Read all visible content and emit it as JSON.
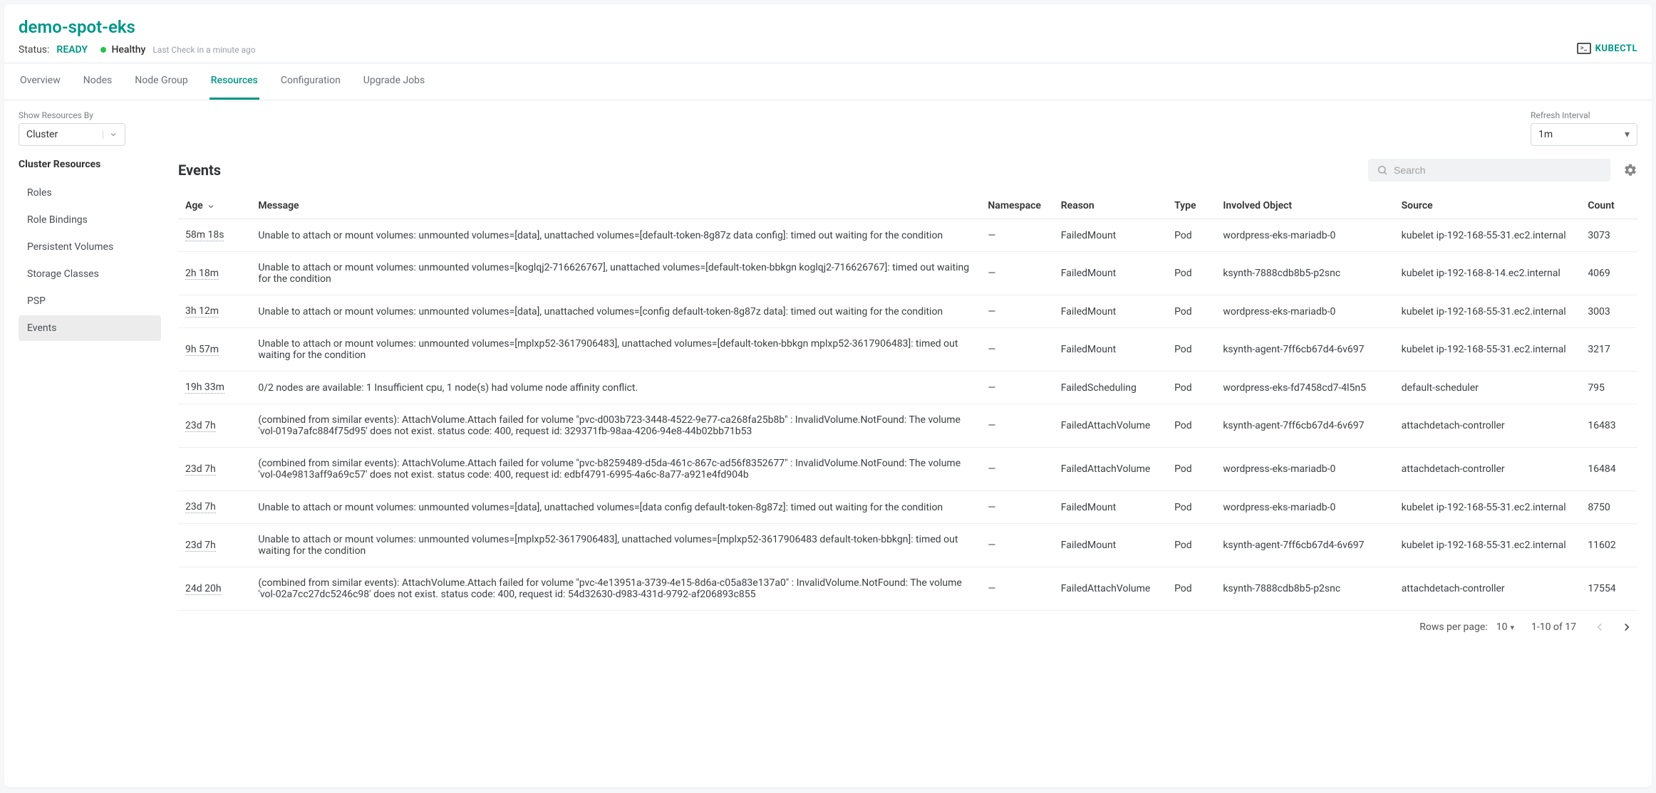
{
  "header": {
    "title": "demo-spot-eks",
    "status_label": "Status:",
    "status_value": "READY",
    "health": "Healthy",
    "last_check": "Last Check in a minute ago",
    "kubectl_label": "KUBECTL"
  },
  "tabs": [
    "Overview",
    "Nodes",
    "Node Group",
    "Resources",
    "Configuration",
    "Upgrade Jobs"
  ],
  "active_tab": "Resources",
  "show_resources_by": {
    "label": "Show Resources By",
    "value": "Cluster"
  },
  "refresh_interval": {
    "label": "Refresh Interval",
    "value": "1m"
  },
  "sidebar": {
    "title": "Cluster Resources",
    "items": [
      "Roles",
      "Role Bindings",
      "Persistent Volumes",
      "Storage Classes",
      "PSP",
      "Events"
    ],
    "active": "Events"
  },
  "events": {
    "title": "Events",
    "search_placeholder": "Search",
    "columns": [
      "Age",
      "Message",
      "Namespace",
      "Reason",
      "Type",
      "Involved Object",
      "Source",
      "Count"
    ],
    "rows": [
      {
        "age": "58m 18s",
        "message": "Unable to attach or mount volumes: unmounted volumes=[data], unattached volumes=[default-token-8g87z data config]: timed out waiting for the condition",
        "namespace": "—",
        "reason": "FailedMount",
        "type": "Pod",
        "involved": "wordpress-eks-mariadb-0",
        "source": "kubelet ip-192-168-55-31.ec2.internal",
        "count": "3073"
      },
      {
        "age": "2h 18m",
        "message": "Unable to attach or mount volumes: unmounted volumes=[koglqj2-716626767], unattached volumes=[default-token-bbkgn koglqj2-716626767]: timed out waiting for the condition",
        "namespace": "—",
        "reason": "FailedMount",
        "type": "Pod",
        "involved": "ksynth-7888cdb8b5-p2snc",
        "source": "kubelet ip-192-168-8-14.ec2.internal",
        "count": "4069"
      },
      {
        "age": "3h 12m",
        "message": "Unable to attach or mount volumes: unmounted volumes=[data], unattached volumes=[config default-token-8g87z data]: timed out waiting for the condition",
        "namespace": "—",
        "reason": "FailedMount",
        "type": "Pod",
        "involved": "wordpress-eks-mariadb-0",
        "source": "kubelet ip-192-168-55-31.ec2.internal",
        "count": "3003"
      },
      {
        "age": "9h 57m",
        "message": "Unable to attach or mount volumes: unmounted volumes=[mplxp52-3617906483], unattached volumes=[default-token-bbkgn mplxp52-3617906483]: timed out waiting for the condition",
        "namespace": "—",
        "reason": "FailedMount",
        "type": "Pod",
        "involved": "ksynth-agent-7ff6cb67d4-6v697",
        "source": "kubelet ip-192-168-55-31.ec2.internal",
        "count": "3217"
      },
      {
        "age": "19h 33m",
        "message": "0/2 nodes are available: 1 Insufficient cpu, 1 node(s) had volume node affinity conflict.",
        "namespace": "—",
        "reason": "FailedScheduling",
        "type": "Pod",
        "involved": "wordpress-eks-fd7458cd7-4l5n5",
        "source": "default-scheduler",
        "count": "795"
      },
      {
        "age": "23d 7h",
        "message": "(combined from similar events): AttachVolume.Attach failed for volume \"pvc-d003b723-3448-4522-9e77-ca268fa25b8b\" : InvalidVolume.NotFound: The volume 'vol-019a7afc884f75d95' does not exist. status code: 400, request id: 329371fb-98aa-4206-94e8-44b02bb71b53",
        "namespace": "—",
        "reason": "FailedAttachVolume",
        "type": "Pod",
        "involved": "ksynth-agent-7ff6cb67d4-6v697",
        "source": "attachdetach-controller",
        "count": "16483"
      },
      {
        "age": "23d 7h",
        "message": "(combined from similar events): AttachVolume.Attach failed for volume \"pvc-b8259489-d5da-461c-867c-ad56f8352677\" : InvalidVolume.NotFound: The volume 'vol-04e9813aff9a69c57' does not exist. status code: 400, request id: edbf4791-6995-4a6c-8a77-a921e4fd904b",
        "namespace": "—",
        "reason": "FailedAttachVolume",
        "type": "Pod",
        "involved": "wordpress-eks-mariadb-0",
        "source": "attachdetach-controller",
        "count": "16484"
      },
      {
        "age": "23d 7h",
        "message": "Unable to attach or mount volumes: unmounted volumes=[data], unattached volumes=[data config default-token-8g87z]: timed out waiting for the condition",
        "namespace": "—",
        "reason": "FailedMount",
        "type": "Pod",
        "involved": "wordpress-eks-mariadb-0",
        "source": "kubelet ip-192-168-55-31.ec2.internal",
        "count": "8750"
      },
      {
        "age": "23d 7h",
        "message": "Unable to attach or mount volumes: unmounted volumes=[mplxp52-3617906483], unattached volumes=[mplxp52-3617906483 default-token-bbkgn]: timed out waiting for the condition",
        "namespace": "—",
        "reason": "FailedMount",
        "type": "Pod",
        "involved": "ksynth-agent-7ff6cb67d4-6v697",
        "source": "kubelet ip-192-168-55-31.ec2.internal",
        "count": "11602"
      },
      {
        "age": "24d 20h",
        "message": "(combined from similar events): AttachVolume.Attach failed for volume \"pvc-4e13951a-3739-4e15-8d6a-c05a83e137a0\" : InvalidVolume.NotFound: The volume 'vol-02a7cc27dc5246c98' does not exist. status code: 400, request id: 54d32630-d983-431d-9792-af206893c855",
        "namespace": "—",
        "reason": "FailedAttachVolume",
        "type": "Pod",
        "involved": "ksynth-7888cdb8b5-p2snc",
        "source": "attachdetach-controller",
        "count": "17554"
      }
    ]
  },
  "pagination": {
    "rows_per_page_label": "Rows per page:",
    "rows_per_page_value": "10",
    "range": "1-10 of 17"
  }
}
